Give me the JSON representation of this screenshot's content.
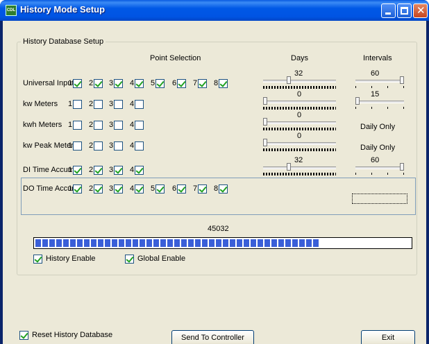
{
  "window": {
    "title": "History Mode Setup",
    "app_icon_text": "CDL"
  },
  "group": {
    "title": "History Database Setup"
  },
  "headers": {
    "point_selection": "Point Selection",
    "days": "Days",
    "intervals": "Intervals"
  },
  "rows": [
    {
      "label": "Universal Inputs",
      "points": [
        {
          "n": "1",
          "checked": true
        },
        {
          "n": "2",
          "checked": true
        },
        {
          "n": "3",
          "checked": true
        },
        {
          "n": "4",
          "checked": true
        },
        {
          "n": "5",
          "checked": true
        },
        {
          "n": "6",
          "checked": true
        },
        {
          "n": "7",
          "checked": true
        },
        {
          "n": "8",
          "checked": true
        }
      ],
      "days": "32",
      "days_slider": 0.34,
      "interval": "60",
      "interval_slider": 1.0
    },
    {
      "label": "kw Meters",
      "points": [
        {
          "n": "1",
          "checked": false
        },
        {
          "n": "2",
          "checked": false
        },
        {
          "n": "3",
          "checked": false
        },
        {
          "n": "4",
          "checked": false
        }
      ],
      "days": "0",
      "days_slider": 0.0,
      "interval": "15",
      "interval_slider": 0.0
    },
    {
      "label": "kwh Meters",
      "points": [
        {
          "n": "1",
          "checked": false
        },
        {
          "n": "2",
          "checked": false
        },
        {
          "n": "3",
          "checked": false
        },
        {
          "n": "4",
          "checked": false
        }
      ],
      "days": "0",
      "days_slider": 0.0,
      "interval_text": "Daily Only"
    },
    {
      "label": "kw Peak Meters",
      "points": [
        {
          "n": "1",
          "checked": false
        },
        {
          "n": "2",
          "checked": false
        },
        {
          "n": "3",
          "checked": false
        },
        {
          "n": "4",
          "checked": false
        }
      ],
      "days": "0",
      "days_slider": 0.0,
      "interval_text": "Daily Only"
    },
    {
      "label": "DI Time Accum.",
      "points": [
        {
          "n": "1",
          "checked": true
        },
        {
          "n": "2",
          "checked": true
        },
        {
          "n": "3",
          "checked": true
        },
        {
          "n": "4",
          "checked": true
        }
      ],
      "days": "32",
      "days_slider": 0.34,
      "interval": "60",
      "interval_slider": 1.0
    },
    {
      "label": "DO Time Accum.",
      "points": [
        {
          "n": "1",
          "checked": true
        },
        {
          "n": "2",
          "checked": true
        },
        {
          "n": "3",
          "checked": true
        },
        {
          "n": "4",
          "checked": true
        },
        {
          "n": "5",
          "checked": true
        },
        {
          "n": "6",
          "checked": true
        },
        {
          "n": "7",
          "checked": true
        },
        {
          "n": "8",
          "checked": true
        }
      ]
    }
  ],
  "progress": {
    "value_text": "45032",
    "fraction": 0.75
  },
  "options": {
    "history_enable": {
      "label": "History Enable",
      "checked": true
    },
    "global_enable": {
      "label": "Global Enable",
      "checked": true
    }
  },
  "footer": {
    "reset_label": "Reset History Database",
    "reset_checked": true,
    "send_button": "Send To Controller",
    "exit_button": "Exit"
  }
}
